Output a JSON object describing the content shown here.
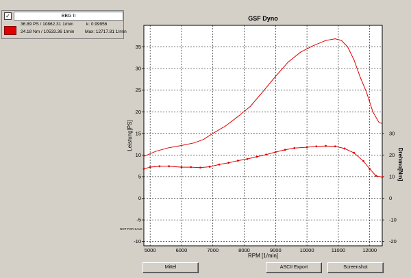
{
  "legend": {
    "checkbox_mark": "✓",
    "name": "BBG II",
    "line1_left": "36.89 PS / 10862.31 1/min",
    "line1_right": "k: 0.99956",
    "line2_left": "24.18 Nm / 10533.36 1/min",
    "line2_right": "Max: 12717.81 1/min",
    "swatch_color": "#e00000"
  },
  "buttons": {
    "mittel": "Mittel",
    "ascii_export": "ASCII Export",
    "screenshot": "Screenshot"
  },
  "watermark": "NOT FOR SALE",
  "chart_data": {
    "type": "line",
    "title": "GSF Dyno",
    "xlabel": "RPM [1/min]",
    "ylabel": "Leistung[PS]",
    "y2label": "Drehmo[Nm]",
    "xlim": [
      4800,
      12400
    ],
    "ylim": [
      -11,
      40
    ],
    "y2lim": [
      -22,
      80
    ],
    "x_ticks": [
      5000,
      6000,
      7000,
      8000,
      9000,
      10000,
      11000,
      12000
    ],
    "y_ticks": [
      -10,
      -5,
      0,
      5,
      10,
      15,
      20,
      25,
      30,
      35
    ],
    "y2_ticks": [
      -20,
      -10,
      0,
      10,
      20,
      30
    ],
    "grid": true,
    "series": [
      {
        "name": "Leistung",
        "axis": "left",
        "markers": false,
        "x": [
          4800,
          5200,
          5600,
          6000,
          6400,
          6700,
          7000,
          7400,
          7800,
          8200,
          8600,
          9000,
          9400,
          9800,
          10200,
          10600,
          10900,
          11100,
          11300,
          11500,
          11700,
          11900,
          12100,
          12300,
          12400
        ],
        "y": [
          9.7,
          10.9,
          11.7,
          12.2,
          12.8,
          13.6,
          15.0,
          16.7,
          18.9,
          21.3,
          24.7,
          28.2,
          31.5,
          33.8,
          35.3,
          36.5,
          36.9,
          36.5,
          35.0,
          32.0,
          28.0,
          24.5,
          20.0,
          17.5,
          17.3
        ]
      },
      {
        "name": "Drehmoment",
        "axis": "right",
        "markers": true,
        "x": [
          4800,
          5000,
          5300,
          5600,
          6000,
          6300,
          6600,
          6900,
          7200,
          7500,
          7800,
          8100,
          8400,
          8700,
          9000,
          9300,
          9600,
          10000,
          10300,
          10600,
          10900,
          11200,
          11500,
          11800,
          12000,
          12200,
          12400
        ],
        "y": [
          13.6,
          14.4,
          14.8,
          14.8,
          14.4,
          14.4,
          14.2,
          14.6,
          15.6,
          16.4,
          17.4,
          18.2,
          19.2,
          20.2,
          21.4,
          22.4,
          23.2,
          23.6,
          24.0,
          24.2,
          24.0,
          23.0,
          21.0,
          17.2,
          13.6,
          10.4,
          9.8
        ]
      }
    ]
  }
}
